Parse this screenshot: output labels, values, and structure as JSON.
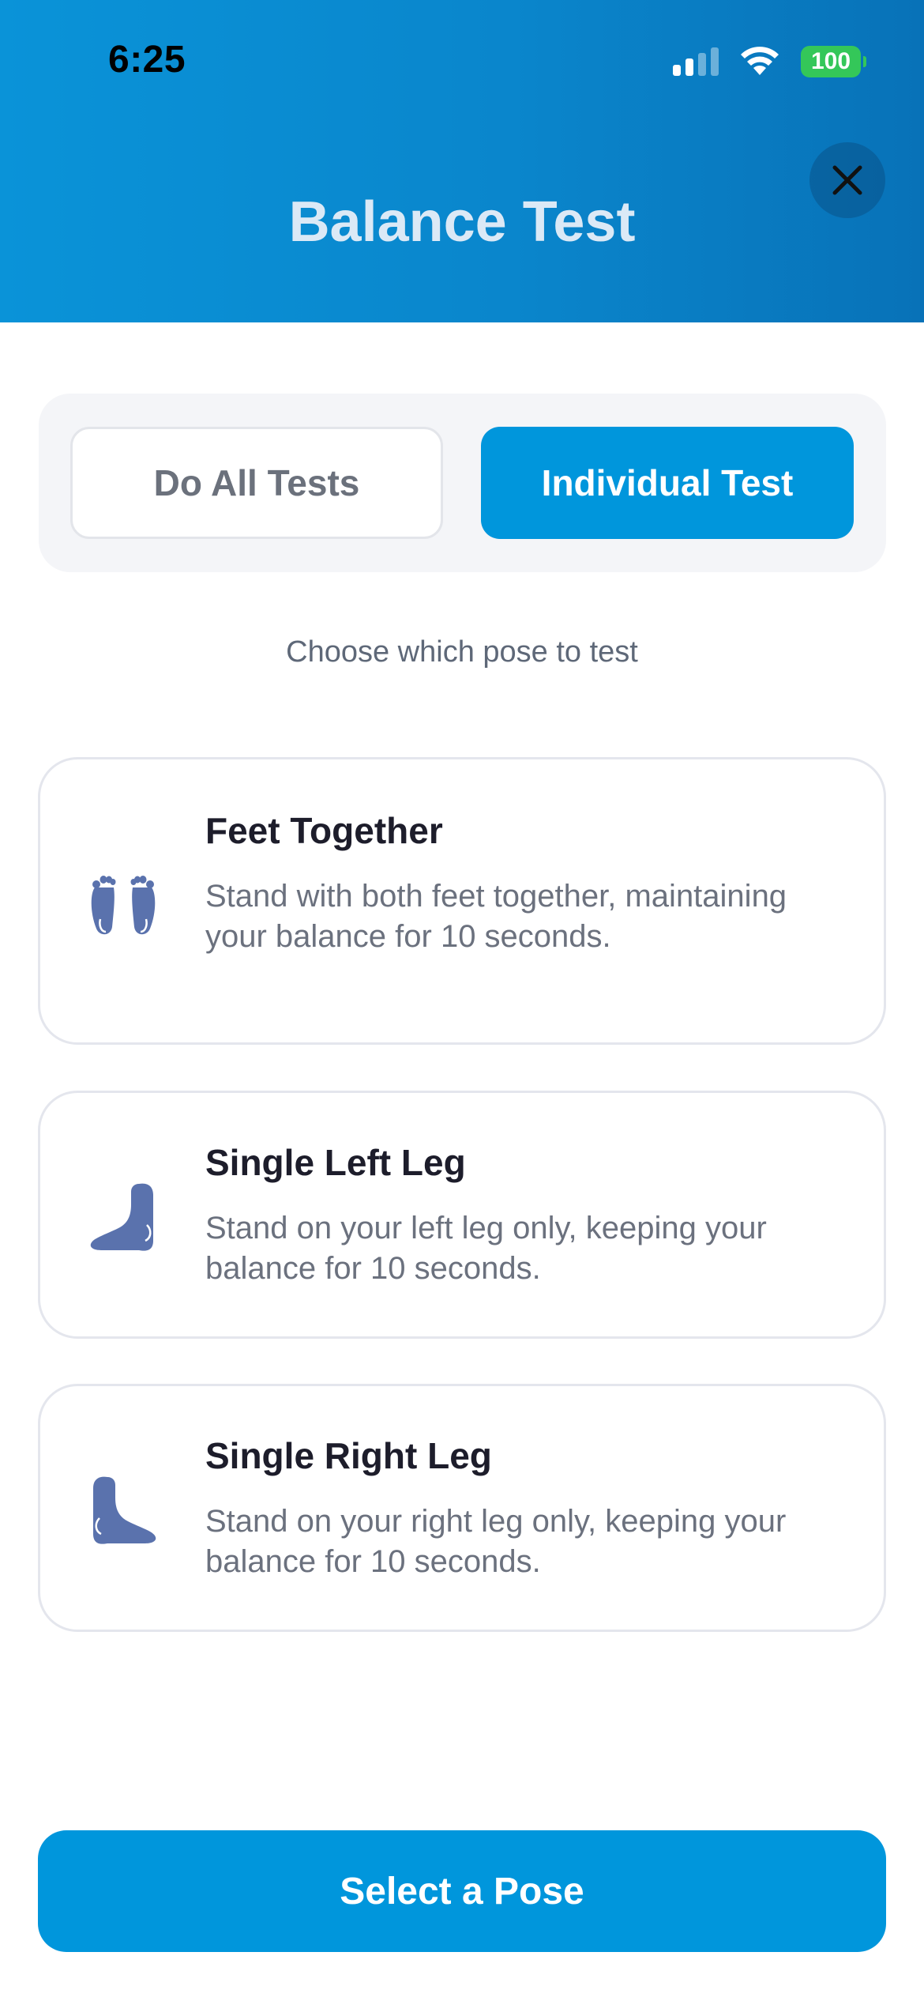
{
  "status_bar": {
    "time": "6:25",
    "battery": "100",
    "icons": [
      "signal-icon",
      "wifi-icon",
      "battery-icon"
    ]
  },
  "header": {
    "title": "Balance Test",
    "close_icon": "close-icon"
  },
  "mode_toggle": {
    "options": [
      {
        "label": "Do All Tests",
        "selected": false
      },
      {
        "label": "Individual Test",
        "selected": true
      }
    ]
  },
  "subtitle": "Choose which pose to test",
  "poses": [
    {
      "title": "Feet Together",
      "description": "Stand with both feet together, maintaining your balance for 10 seconds.",
      "icon": "feet-together-icon"
    },
    {
      "title": "Single Left Leg",
      "description": "Stand on your left leg only, keeping your balance for 10 seconds.",
      "icon": "left-foot-icon"
    },
    {
      "title": "Single Right Leg",
      "description": "Stand on your right leg only, keeping your balance for 10 seconds.",
      "icon": "right-foot-icon"
    }
  ],
  "action_button": {
    "label": "Select a Pose"
  },
  "colors": {
    "primary": "#0096dc",
    "header_gradient_start": "#0a93d8",
    "header_gradient_end": "#0872b8",
    "icon": "#5a72ad",
    "battery": "#34c759"
  }
}
